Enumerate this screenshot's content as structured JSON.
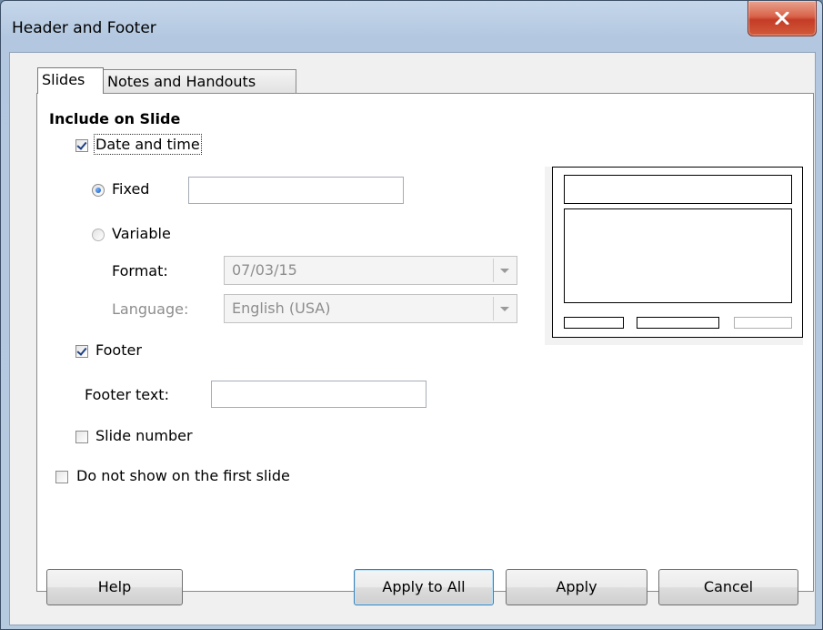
{
  "window": {
    "title": "Header and Footer",
    "close_glyph": "✕"
  },
  "tabs": [
    {
      "label": "Slides",
      "active": true
    },
    {
      "label": "Notes and Handouts",
      "active": false
    }
  ],
  "form": {
    "section_title": "Include on Slide",
    "date_and_time": {
      "label": "Date and time",
      "checked": true
    },
    "fixed": {
      "label": "Fixed",
      "selected": true,
      "value": ""
    },
    "variable": {
      "label": "Variable",
      "selected": false
    },
    "format": {
      "label": "Format:",
      "value": "07/03/15"
    },
    "language": {
      "label": "Language:",
      "value": "English (USA)"
    },
    "footer": {
      "label": "Footer",
      "checked": true
    },
    "footer_text": {
      "label": "Footer text:",
      "value": ""
    },
    "slide_number": {
      "label": "Slide number",
      "checked": false
    },
    "not_first": {
      "label": "Do not show on the first slide",
      "checked": false
    }
  },
  "buttons": {
    "help": "Help",
    "apply_to_all": "Apply to All",
    "apply": "Apply",
    "cancel": "Cancel"
  },
  "icons": {
    "close": "close-icon",
    "dropdown": "chevron-down-icon"
  },
  "colors": {
    "titlebar": "#b9cde4",
    "close_button": "#c94a30",
    "default_button_border": "#3c7fb1"
  }
}
